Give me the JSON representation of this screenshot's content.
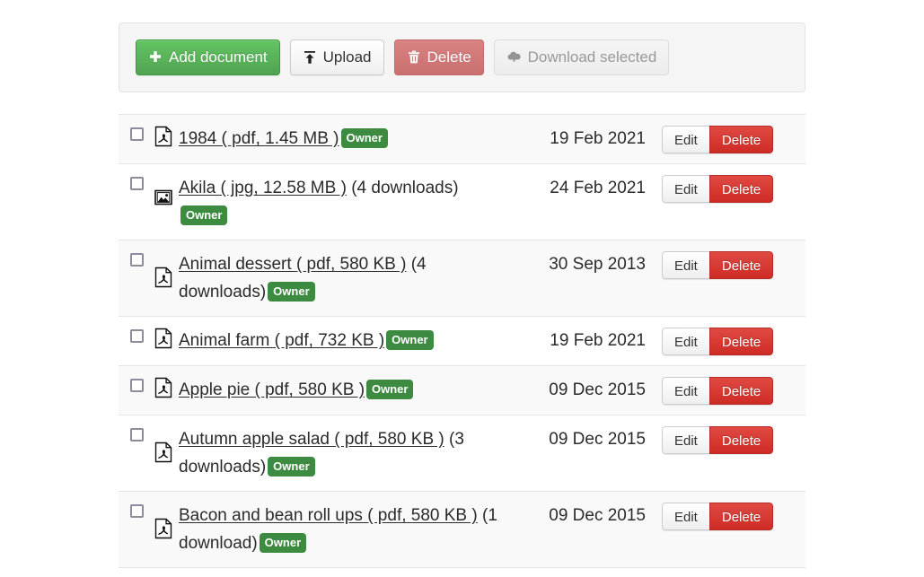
{
  "toolbar": {
    "add_label": "Add document",
    "add_icon": "plus-icon",
    "upload_label": "Upload",
    "upload_icon": "upload-arrow-icon",
    "delete_label": "Delete",
    "delete_icon": "trash-icon",
    "download_label": "Download selected",
    "download_icon": "cloud-download-icon",
    "accent_green": "#5cb85c",
    "accent_red": "#d07b7b",
    "disabled_text": "#999999"
  },
  "table": {
    "edit_label": "Edit",
    "delete_label": "Delete",
    "badge_color": "#3d8b40",
    "rows": [
      {
        "icon": "pdf-file-icon",
        "link": "1984 ( pdf, 1.45 MB )",
        "downloads": "",
        "badge": "Owner",
        "date": "19 Feb 2021"
      },
      {
        "icon": "image-file-icon",
        "link": "Akila ( jpg, 12.58 MB )",
        "downloads": " (4 downloads)",
        "badge": "Owner",
        "date": "24 Feb 2021"
      },
      {
        "icon": "pdf-file-icon",
        "link": "Animal dessert ( pdf, 580 KB )",
        "downloads": " (4 downloads)",
        "badge": "Owner",
        "date": "30 Sep 2013"
      },
      {
        "icon": "pdf-file-icon",
        "link": "Animal farm ( pdf, 732 KB )",
        "downloads": "",
        "badge": "Owner",
        "date": "19 Feb 2021"
      },
      {
        "icon": "pdf-file-icon",
        "link": "Apple pie ( pdf, 580 KB )",
        "downloads": "",
        "badge": "Owner",
        "date": "09 Dec 2015"
      },
      {
        "icon": "pdf-file-icon",
        "link": "Autumn apple salad ( pdf, 580 KB )",
        "downloads": " (3 downloads)",
        "badge": "Owner",
        "date": "09 Dec 2015"
      },
      {
        "icon": "pdf-file-icon",
        "link": "Bacon and bean roll ups ( pdf, 580 KB )",
        "downloads": " (1 download)",
        "badge": "Owner",
        "date": "09 Dec 2015"
      }
    ]
  }
}
